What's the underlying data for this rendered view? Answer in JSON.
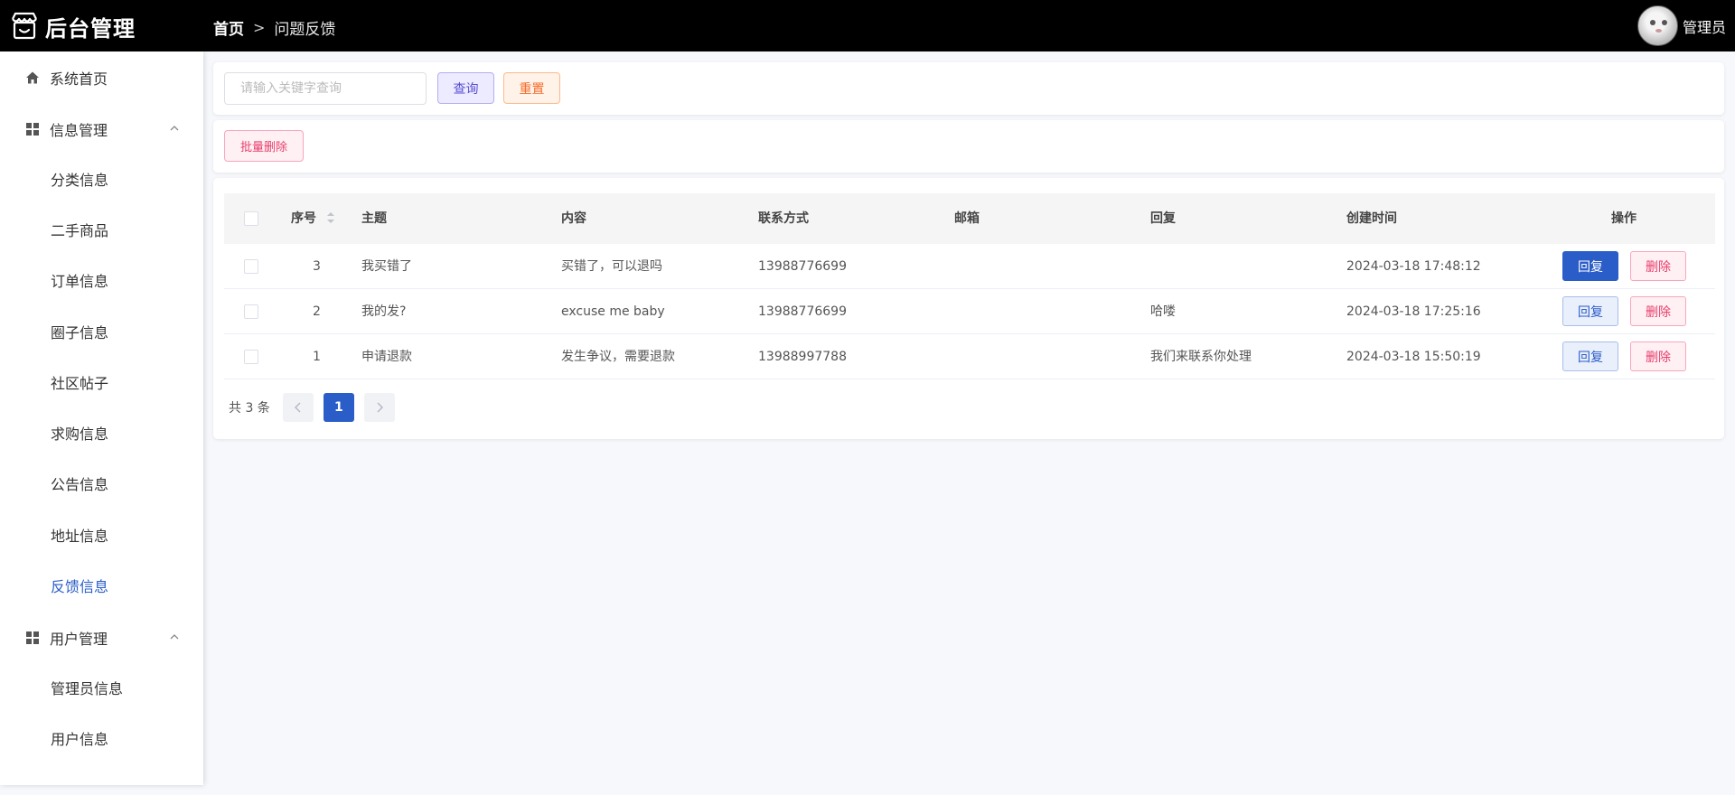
{
  "app": {
    "title": "后台管理"
  },
  "breadcrumb": {
    "home": "首页",
    "separator": ">",
    "current": "问题反馈"
  },
  "user": {
    "name": "管理员"
  },
  "sidebar": {
    "home": "系统首页",
    "info_group": {
      "label": "信息管理",
      "items": [
        "分类信息",
        "二手商品",
        "订单信息",
        "圈子信息",
        "社区帖子",
        "求购信息",
        "公告信息",
        "地址信息",
        "反馈信息"
      ]
    },
    "user_group": {
      "label": "用户管理",
      "items": [
        "管理员信息",
        "用户信息"
      ]
    },
    "active_item": "反馈信息"
  },
  "search": {
    "placeholder": "请输入关键字查询",
    "value": "",
    "query_label": "查询",
    "reset_label": "重置"
  },
  "toolbar": {
    "batch_delete_label": "批量删除"
  },
  "table": {
    "columns": [
      "序号",
      "主题",
      "内容",
      "联系方式",
      "邮箱",
      "回复",
      "创建时间",
      "操作"
    ],
    "rows": [
      {
        "id": "3",
        "title": "我买错了",
        "content": "买错了，可以退吗",
        "contact": "13988776699",
        "email": "",
        "reply": "",
        "created": "2024-03-18 17:48:12"
      },
      {
        "id": "2",
        "title": "我的发?",
        "content": "excuse me baby",
        "contact": "13988776699",
        "email": "",
        "reply": "哈喽",
        "created": "2024-03-18 17:25:16"
      },
      {
        "id": "1",
        "title": "申请退款",
        "content": "发生争议，需要退款",
        "contact": "13988997788",
        "email": "",
        "reply": "我们来联系你处理",
        "created": "2024-03-18 15:50:19"
      }
    ],
    "reply_label": "回复",
    "delete_label": "删除"
  },
  "pagination": {
    "total_text": "共 3 条",
    "current_page": "1",
    "prev_icon": "chevron-left-icon",
    "next_icon": "chevron-right-icon"
  },
  "colors": {
    "header_bg": "#000000",
    "primary": "#2b5dc9",
    "danger": "#e83e6b",
    "query_accent": "#5a4fd1",
    "reset_accent": "#f56c2b",
    "page_bg": "#f7f8fc"
  }
}
